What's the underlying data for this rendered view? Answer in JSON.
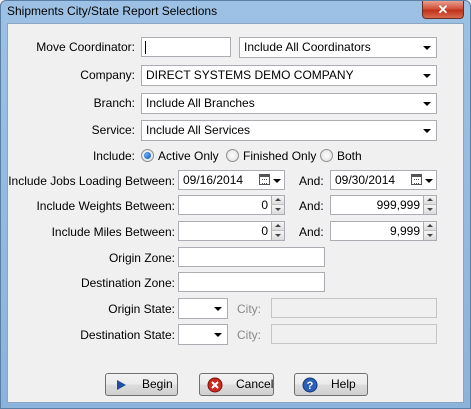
{
  "window": {
    "title": "Shipments City/State Report Selections",
    "close_glyph": "✕"
  },
  "form": {
    "move_coordinator": {
      "label": "Move Coordinator:",
      "value": "",
      "select_value": "Include All Coordinators"
    },
    "company": {
      "label": "Company:",
      "value": "DIRECT SYSTEMS DEMO COMPANY"
    },
    "branch": {
      "label": "Branch:",
      "value": "Include All Branches"
    },
    "service": {
      "label": "Service:",
      "value": "Include All Services"
    },
    "include": {
      "label": "Include:",
      "options": [
        {
          "label": "Active Only",
          "checked": true
        },
        {
          "label": "Finished Only",
          "checked": false
        },
        {
          "label": "Both",
          "checked": false
        }
      ]
    },
    "jobs_loading": {
      "label": "Include Jobs Loading Between:",
      "from": "09/16/2014",
      "and_label": "And:",
      "to": "09/30/2014"
    },
    "weights": {
      "label": "Include Weights Between:",
      "from": "0",
      "and_label": "And:",
      "to": "999,999"
    },
    "miles": {
      "label": "Include Miles Between:",
      "from": "0",
      "and_label": "And:",
      "to": "9,999"
    },
    "origin_zone": {
      "label": "Origin Zone:",
      "value": ""
    },
    "destination_zone": {
      "label": "Destination Zone:",
      "value": ""
    },
    "origin_state": {
      "label": "Origin State:",
      "value": "",
      "city_label": "City:",
      "city_value": ""
    },
    "destination_state": {
      "label": "Destination State:",
      "value": "",
      "city_label": "City:",
      "city_value": ""
    }
  },
  "buttons": {
    "begin": {
      "label": "Begin",
      "icon": "play-icon"
    },
    "cancel": {
      "label": "Cancel",
      "icon": "cancel-icon"
    },
    "help": {
      "label": "Help",
      "icon": "help-icon"
    }
  },
  "colors": {
    "titlebar": "#9cc1e4",
    "close": "#c0311a",
    "radio_checked": "#0b4fa8"
  }
}
